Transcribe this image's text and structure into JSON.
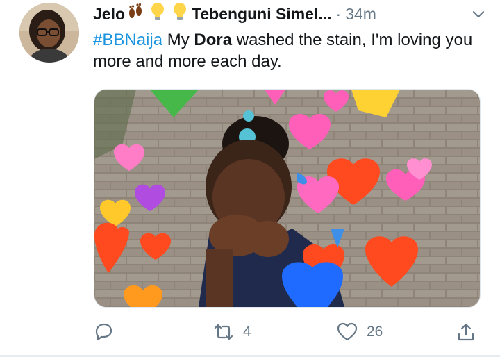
{
  "tweet": {
    "author_name": "Jelo",
    "author_emojis": [
      "feet-emoji",
      "lightbulb-emoji",
      "lightbulb-emoji"
    ],
    "author_handle_trunc": "Tebenguni Simel...",
    "separator": "·",
    "timestamp": "34m",
    "text_parts": {
      "hashtag": "#BBNaija",
      "pre": " My ",
      "bold": "Dora",
      "post": " washed the stain,   I'm loving you more and more each day."
    },
    "media": {
      "description_icon": "gif-media"
    },
    "actions": {
      "reply_count": "",
      "retweet_count": "4",
      "like_count": "26"
    }
  },
  "colors": {
    "link": "#1b95e0",
    "secondary": "#657786",
    "text": "#14171a"
  },
  "icons": {
    "reply": "reply-icon",
    "retweet": "retweet-icon",
    "like": "heart-icon",
    "share": "share-icon",
    "more": "chevron-down-icon"
  }
}
